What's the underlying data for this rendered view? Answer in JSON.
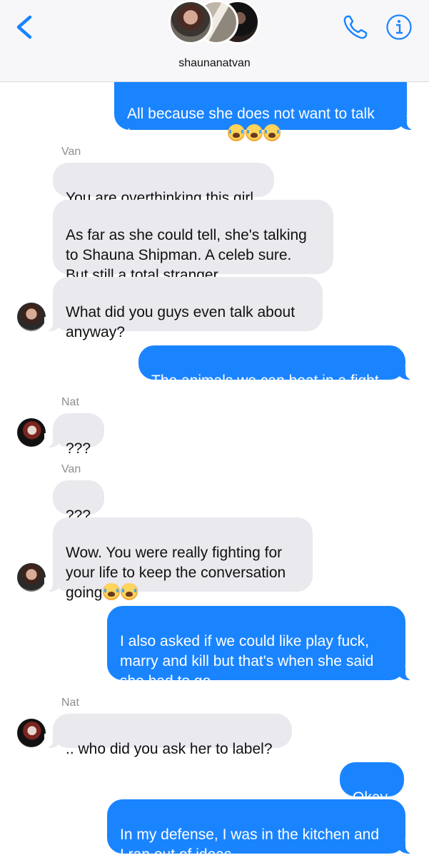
{
  "header": {
    "group_name": "shaunanatvan",
    "icons": {
      "back": "chevron-left-icon",
      "call": "phone-icon",
      "info": "info-icon"
    },
    "accent_color": "#1a84ff"
  },
  "messages": [
    {
      "from": "me",
      "text": "All because she does not want to talk\nto me anymore",
      "emoji": [
        "loudly-crying-face",
        "loudly-crying-face",
        "loudly-crying-face"
      ]
    },
    {
      "sender_label": "Van"
    },
    {
      "from": "Van",
      "text": "You are overthinking this girl"
    },
    {
      "from": "Van",
      "text": "As far as she could tell, she's talking\nto Shauna Shipman. A celeb sure.\nBut still a total stranger"
    },
    {
      "from": "Van",
      "text": "What did you guys even talk about\nanyway?"
    },
    {
      "from": "me",
      "text": "The animals we can beat in a fight"
    },
    {
      "sender_label": "Nat"
    },
    {
      "from": "Nat",
      "text": "???"
    },
    {
      "sender_label": "Van"
    },
    {
      "from": "Van",
      "text": "???"
    },
    {
      "from": "Van",
      "text": "Wow. You were really fighting for\nyour life to keep the conversation\ngoing",
      "emoji": [
        "loudly-crying-face",
        "loudly-crying-face"
      ]
    },
    {
      "from": "me",
      "text": "I also asked if we could like play fuck,\nmarry and kill but that's when she said\nshe had to go"
    },
    {
      "sender_label": "Nat"
    },
    {
      "from": "Nat",
      "text": ".. who did you ask her to label?"
    },
    {
      "from": "me",
      "text": "Okay"
    },
    {
      "from": "me",
      "text": "In my defense, I was in the kitchen and\nI ran out of ideas"
    }
  ],
  "colors": {
    "outgoing_bubble": "#1a84ff",
    "incoming_bubble": "#e9e9ee",
    "sender_label": "#8e8e93"
  }
}
